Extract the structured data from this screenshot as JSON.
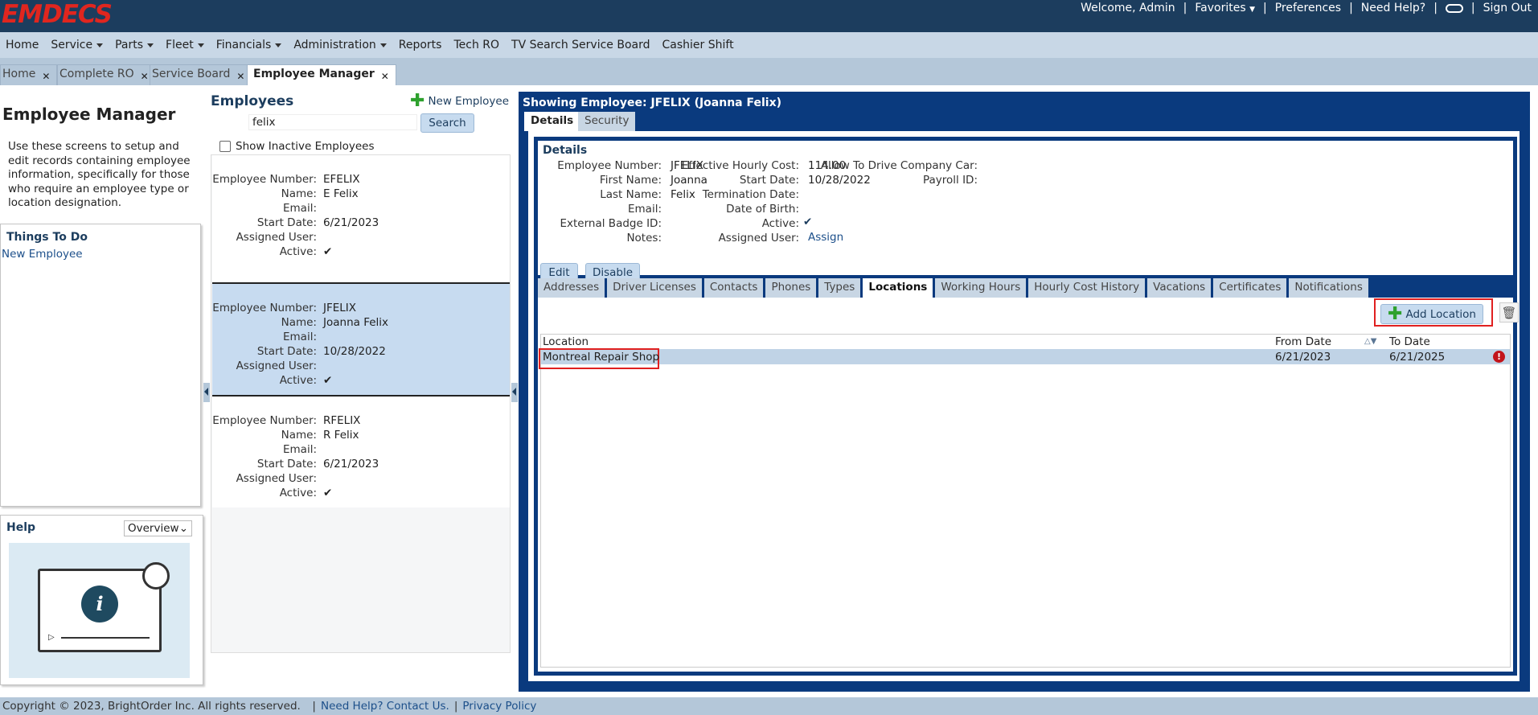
{
  "brand": {
    "logo": "EMDECS"
  },
  "toplinks": {
    "welcome": "Welcome, Admin",
    "favorites": "Favorites",
    "preferences": "Preferences",
    "help": "Need Help?",
    "signout": "Sign Out"
  },
  "menu": [
    {
      "label": "Home"
    },
    {
      "label": "Service"
    },
    {
      "label": "Parts"
    },
    {
      "label": "Fleet"
    },
    {
      "label": "Financials"
    },
    {
      "label": "Administration"
    },
    {
      "label": "Reports"
    },
    {
      "label": "Tech RO"
    },
    {
      "label": "TV Search Service Board"
    },
    {
      "label": "Cashier Shift"
    }
  ],
  "tabs": [
    {
      "label": "Home"
    },
    {
      "label": "Complete RO"
    },
    {
      "label": "Service Board"
    },
    {
      "label": "Employee Manager"
    }
  ],
  "left": {
    "title": "Employee Manager",
    "description": "Use these screens to setup and edit records containing employee information, specifically for those who require an employee type or location designation.",
    "todo_title": "Things To Do",
    "todo_link": "New Employee",
    "help_title": "Help",
    "help_select": "Overview"
  },
  "employees": {
    "title": "Employees",
    "new_label": "New Employee",
    "search_value": "felix",
    "search_button": "Search",
    "inactive_label": "Show Inactive Employees",
    "labels": {
      "number": "Employee Number:",
      "name": "Name:",
      "email": "Email:",
      "start": "Start Date:",
      "user": "Assigned User:",
      "active": "Active:"
    },
    "list": [
      {
        "number": "EFELIX",
        "name": "E Felix",
        "email": "",
        "start": "6/21/2023",
        "user": "",
        "active": "✔"
      },
      {
        "number": "JFELIX",
        "name": "Joanna Felix",
        "email": "",
        "start": "10/28/2022",
        "user": "",
        "active": "✔"
      },
      {
        "number": "RFELIX",
        "name": "R Felix",
        "email": "",
        "start": "6/21/2023",
        "user": "",
        "active": "✔"
      }
    ]
  },
  "detail": {
    "title": "Showing Employee: JFELIX (Joanna Felix)",
    "tab_details": "Details",
    "tab_security": "Security",
    "section": "Details",
    "fields": {
      "emp_num_k": "Employee Number:",
      "emp_num_v": "JFELIX",
      "first_k": "First Name:",
      "first_v": "Joanna",
      "last_k": "Last Name:",
      "last_v": "Felix",
      "email_k": "Email:",
      "badge_k": "External Badge ID:",
      "notes_k": "Notes:",
      "cost_k": "Effective Hourly Cost:",
      "cost_v": "114.00",
      "start_k": "Start Date:",
      "start_v": "10/28/2022",
      "term_k": "Termination Date:",
      "dob_k": "Date of Birth:",
      "active_k": "Active:",
      "active_v": "✔",
      "assigned_k": "Assigned User:",
      "assigned_v": "Assign",
      "car_k": "Allow To Drive Company Car:",
      "payroll_k": "Payroll ID:"
    },
    "edit_button": "Edit",
    "disable_button": "Disable",
    "subtabs": [
      "Addresses",
      "Driver Licenses",
      "Contacts",
      "Phones",
      "Types",
      "Locations",
      "Working Hours",
      "Hourly Cost History",
      "Vacations",
      "Certificates",
      "Notifications"
    ],
    "add_location": "Add Location",
    "grid_headers": {
      "location": "Location",
      "from": "From Date",
      "to": "To Date"
    },
    "rows": [
      {
        "location": "Montreal Repair Shop",
        "from": "6/21/2023",
        "to": "6/21/2025"
      }
    ]
  },
  "footer": {
    "copyright": "Copyright © 2023, BrightOrder Inc. All rights reserved.",
    "help": "Need Help? Contact Us.",
    "privacy": "Privacy Policy"
  }
}
